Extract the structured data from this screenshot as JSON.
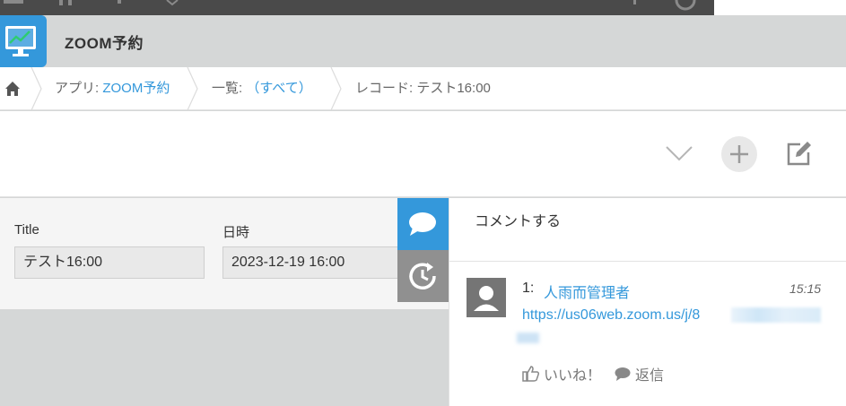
{
  "app": {
    "title": "ZOOM予約"
  },
  "breadcrumb": {
    "app_prefix": "アプリ: ",
    "app_name": "ZOOM予約",
    "list_prefix": "一覧: ",
    "list_name": "（すべて）",
    "record_label": "レコード: テスト16:00"
  },
  "record": {
    "fields": [
      {
        "label": "Title",
        "value": "テスト16:00"
      },
      {
        "label": "日時",
        "value": "2023-12-19 16:00"
      }
    ]
  },
  "comments_panel": {
    "placeholder": "コメントする",
    "comment": {
      "number": "1:",
      "author": "人雨而管理者",
      "time": "15:15",
      "url": "https://us06web.zoom.us/j/8",
      "like_label": "いいね！",
      "reply_label": "返信"
    }
  },
  "colors": {
    "accent": "#3498db",
    "header": "#d5d7d7",
    "topbar": "#4a4a4a",
    "history_tab": "#909090"
  },
  "icons": [
    "app-monitor-icon",
    "home-icon",
    "chevron-down-icon",
    "plus-icon",
    "edit-icon",
    "comment-bubble-icon",
    "history-icon",
    "user-avatar-icon",
    "thumbs-up-icon",
    "reply-bubble-icon"
  ]
}
